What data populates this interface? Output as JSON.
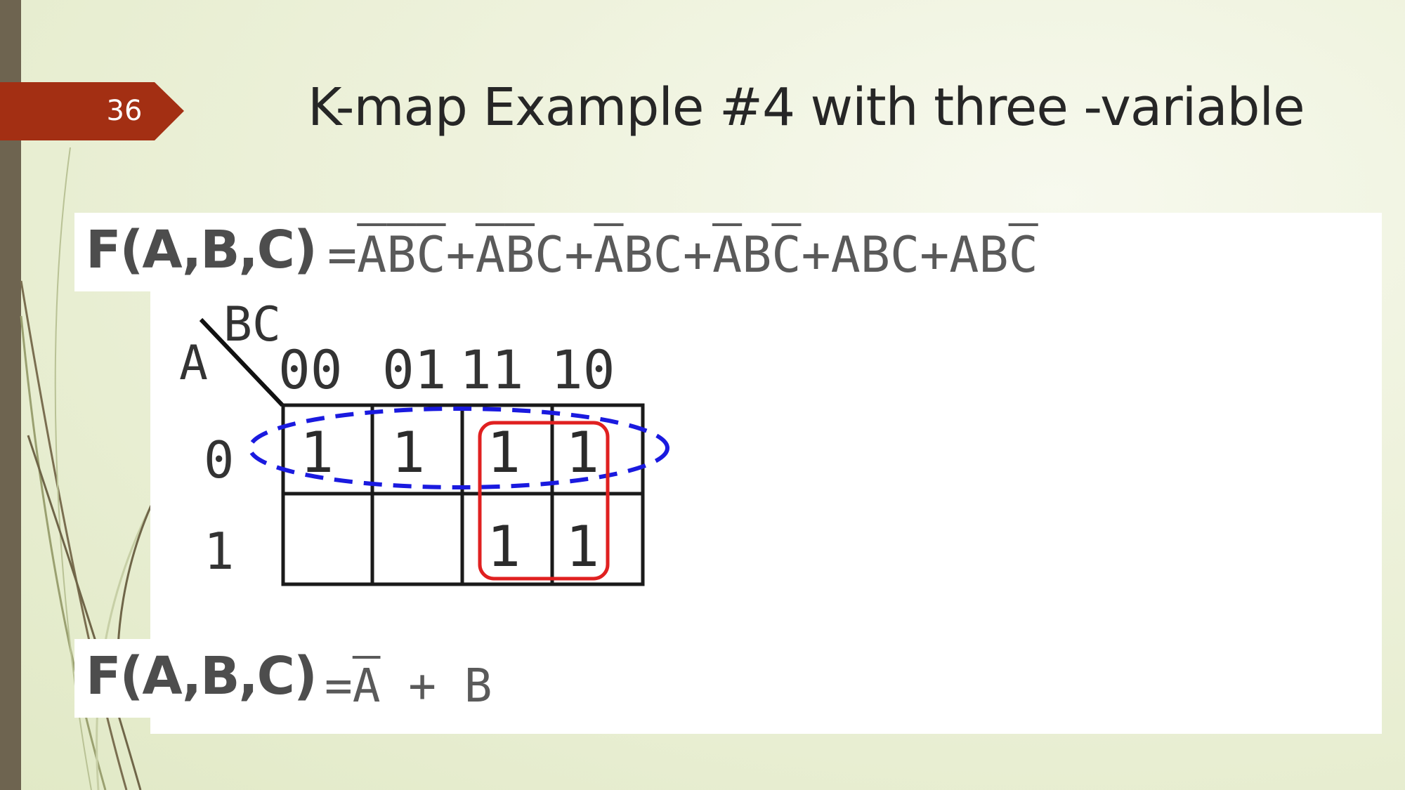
{
  "slide": {
    "number": "36",
    "title": "K-map Example #4 with three -variable"
  },
  "original_function": {
    "label": "F(A,B,C)",
    "equals": "=",
    "terms": [
      [
        "A",
        "B",
        "C"
      ],
      [
        "A",
        "B",
        "C"
      ],
      [
        "A",
        "B",
        "C"
      ],
      [
        "A",
        "B",
        "C"
      ],
      [
        "A",
        "B",
        "C"
      ],
      [
        "A",
        "B",
        "C"
      ]
    ],
    "plus": "+"
  },
  "kmap": {
    "corner_top": "BC",
    "corner_left": "A",
    "column_headers": [
      "00",
      "01",
      "11",
      "10"
    ],
    "row_headers": [
      "0",
      "1"
    ],
    "cells": [
      [
        "1",
        "1",
        "1",
        "1"
      ],
      [
        "",
        "",
        "1",
        "1"
      ]
    ],
    "groups": [
      {
        "style": "dashed-ellipse",
        "color": "#1a1adf",
        "covers": "row A=0"
      },
      {
        "style": "rounded-rectangle",
        "color": "#e02020",
        "covers": "columns BC=11, BC=10"
      }
    ]
  },
  "simplified_function": {
    "label": "F(A,B,C)",
    "equals": "=",
    "a_term": "A",
    "plus": "+",
    "b_term": "B"
  }
}
